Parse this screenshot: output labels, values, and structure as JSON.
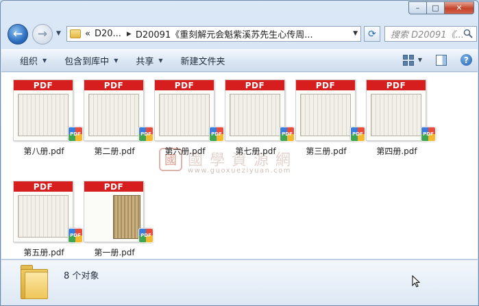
{
  "window": {
    "controls": {
      "minimize": "–",
      "maximize": "□",
      "close": "✕"
    }
  },
  "navigation": {
    "back_icon": "back-arrow-icon",
    "forward_icon": "forward-arrow-icon",
    "address": {
      "overflow": "«",
      "crumb_root": "D20...",
      "crumb_current": "D20091《重刻解元会魁紫溪苏先生心传周..."
    },
    "refresh_icon": "refresh-icon",
    "search_placeholder": "搜索 D20091《..."
  },
  "toolbar": {
    "organize": "组织",
    "include_in_library": "包含到库中",
    "share": "共享",
    "new_folder": "新建文件夹",
    "view_icon": "view-options-icon",
    "preview_pane_icon": "preview-pane-icon",
    "help": "?"
  },
  "files": [
    {
      "name": "第八册.pdf",
      "badge": "PDF",
      "cover": false
    },
    {
      "name": "第二册.pdf",
      "badge": "PDF",
      "cover": false
    },
    {
      "name": "第六册.pdf",
      "badge": "PDF",
      "cover": false
    },
    {
      "name": "第七册.pdf",
      "badge": "PDF",
      "cover": false
    },
    {
      "name": "第三册.pdf",
      "badge": "PDF",
      "cover": false
    },
    {
      "name": "第四册.pdf",
      "badge": "PDF",
      "cover": false
    },
    {
      "name": "第五册.pdf",
      "badge": "PDF",
      "cover": false
    },
    {
      "name": "第一册.pdf",
      "badge": "PDF",
      "cover": true
    }
  ],
  "file_type_badge": "PDF",
  "watermark": {
    "seal": "國",
    "title": "國學資源網",
    "url": "www.guoxueziyuan.com"
  },
  "status": {
    "count": "8 个对象"
  }
}
